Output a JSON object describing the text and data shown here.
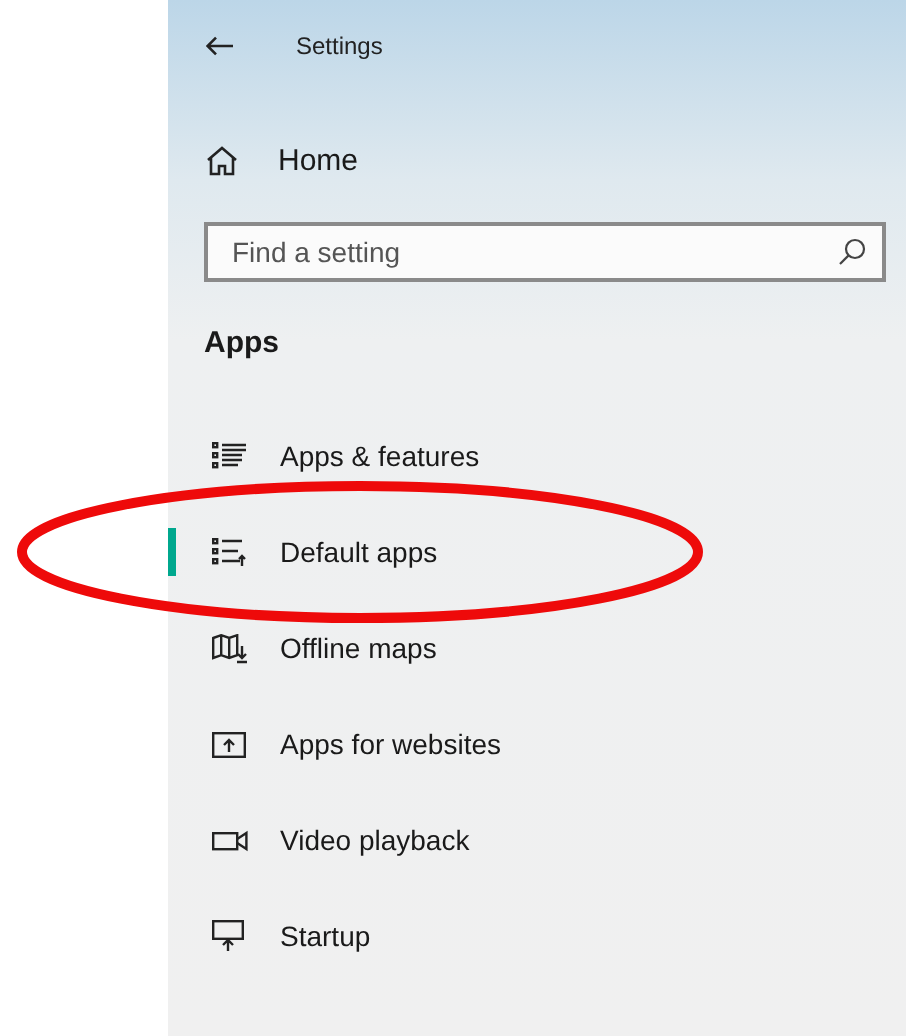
{
  "window": {
    "title": "Settings"
  },
  "home": {
    "label": "Home"
  },
  "search": {
    "placeholder": "Find a setting"
  },
  "section": {
    "heading": "Apps"
  },
  "items": [
    {
      "label": "Apps & features",
      "selected": false,
      "circled": false
    },
    {
      "label": "Default apps",
      "selected": true,
      "circled": true
    },
    {
      "label": "Offline maps",
      "selected": false,
      "circled": false
    },
    {
      "label": "Apps for websites",
      "selected": false,
      "circled": false
    },
    {
      "label": "Video playback",
      "selected": false,
      "circled": false
    },
    {
      "label": "Startup",
      "selected": false,
      "circled": false
    }
  ]
}
